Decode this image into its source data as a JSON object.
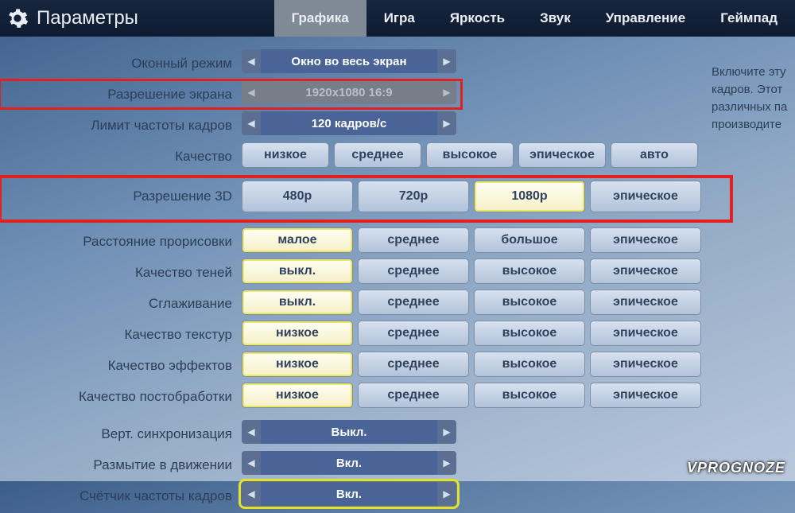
{
  "header": {
    "title": "Параметры",
    "tabs": [
      "Графика",
      "Игра",
      "Яркость",
      "Звук",
      "Управление",
      "Геймпад"
    ],
    "active_tab_index": 0
  },
  "spinners": {
    "window_mode": {
      "label": "Оконный режим",
      "value": "Окно во весь экран",
      "disabled": false
    },
    "resolution": {
      "label": "Разрешение экрана",
      "value": "1920x1080 16:9",
      "disabled": true
    },
    "fps_limit": {
      "label": "Лимит частоты кадров",
      "value": "120 кадров/с",
      "disabled": false
    },
    "vsync": {
      "label": "Верт. синхронизация",
      "value": "Выкл.",
      "disabled": false
    },
    "motion_blur": {
      "label": "Размытие в движении",
      "value": "Вкл.",
      "disabled": false
    },
    "fps_counter": {
      "label": "Счётчик частоты кадров",
      "value": "Вкл.",
      "disabled": false
    }
  },
  "quality": {
    "label": "Качество",
    "options": [
      "низкое",
      "среднее",
      "высокое",
      "эпическое",
      "авто"
    ],
    "selected_index": -1
  },
  "res3d": {
    "label": "Разрешение 3D",
    "options": [
      "480p",
      "720p",
      "1080p",
      "эпическое"
    ],
    "selected_index": 2
  },
  "option_rows": [
    {
      "key": "view_dist",
      "label": "Расстояние прорисовки",
      "options": [
        "малое",
        "среднее",
        "большое",
        "эпическое"
      ],
      "selected_index": 0
    },
    {
      "key": "shadows",
      "label": "Качество теней",
      "options": [
        "выкл.",
        "среднее",
        "высокое",
        "эпическое"
      ],
      "selected_index": 0
    },
    {
      "key": "aa",
      "label": "Сглаживание",
      "options": [
        "выкл.",
        "среднее",
        "высокое",
        "эпическое"
      ],
      "selected_index": 0
    },
    {
      "key": "textures",
      "label": "Качество текстур",
      "options": [
        "низкое",
        "среднее",
        "высокое",
        "эпическое"
      ],
      "selected_index": 0
    },
    {
      "key": "effects",
      "label": "Качество эффектов",
      "options": [
        "низкое",
        "среднее",
        "высокое",
        "эпическое"
      ],
      "selected_index": 0
    },
    {
      "key": "postfx",
      "label": "Качество постобработки",
      "options": [
        "низкое",
        "среднее",
        "высокое",
        "эпическое"
      ],
      "selected_index": 0
    }
  ],
  "description_lines": [
    "Включите эту",
    "кадров. Этот",
    "различных па",
    "производите"
  ],
  "watermark": "VPROGNOZE"
}
